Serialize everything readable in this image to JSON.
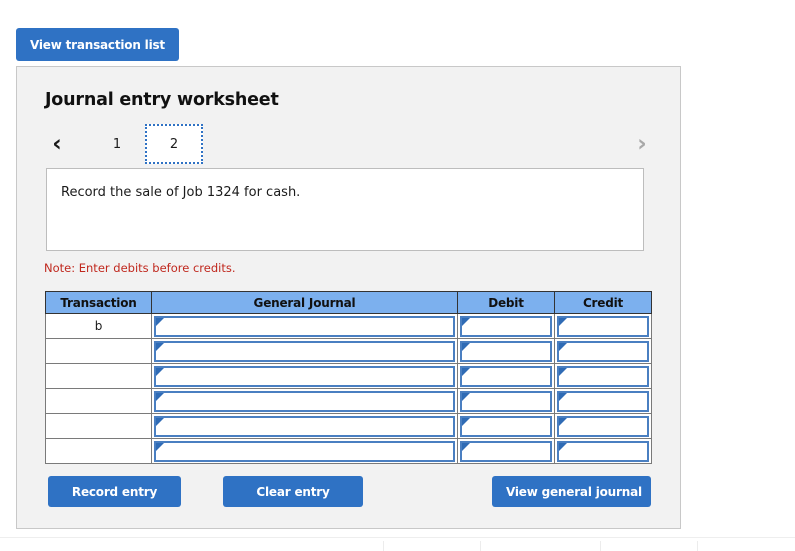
{
  "toolbar": {
    "view_transaction_list_label": "View transaction list"
  },
  "card": {
    "title": "Journal entry worksheet"
  },
  "tabs": {
    "prev_icon": "‹",
    "next_icon": "›",
    "items": [
      {
        "label": "1",
        "selected": false
      },
      {
        "label": "2",
        "selected": true
      }
    ]
  },
  "description": {
    "text": "Record the sale of Job 1324 for cash."
  },
  "note": {
    "text": "Note: Enter debits before credits."
  },
  "table": {
    "headers": [
      "Transaction",
      "General Journal",
      "Debit",
      "Credit"
    ],
    "rows": [
      {
        "transaction": "b",
        "general_journal": "",
        "debit": "",
        "credit": ""
      },
      {
        "transaction": "",
        "general_journal": "",
        "debit": "",
        "credit": ""
      },
      {
        "transaction": "",
        "general_journal": "",
        "debit": "",
        "credit": ""
      },
      {
        "transaction": "",
        "general_journal": "",
        "debit": "",
        "credit": ""
      },
      {
        "transaction": "",
        "general_journal": "",
        "debit": "",
        "credit": ""
      },
      {
        "transaction": "",
        "general_journal": "",
        "debit": "",
        "credit": ""
      }
    ]
  },
  "actions": {
    "record_entry_label": "Record entry",
    "clear_entry_label": "Clear entry",
    "view_general_journal_label": "View general journal"
  },
  "colors": {
    "primary_button": "#2f72c4",
    "table_header": "#7cb0ee",
    "note_red": "#c0281e",
    "card_background": "#f2f2f2",
    "input_border": "#4a7fc1"
  }
}
